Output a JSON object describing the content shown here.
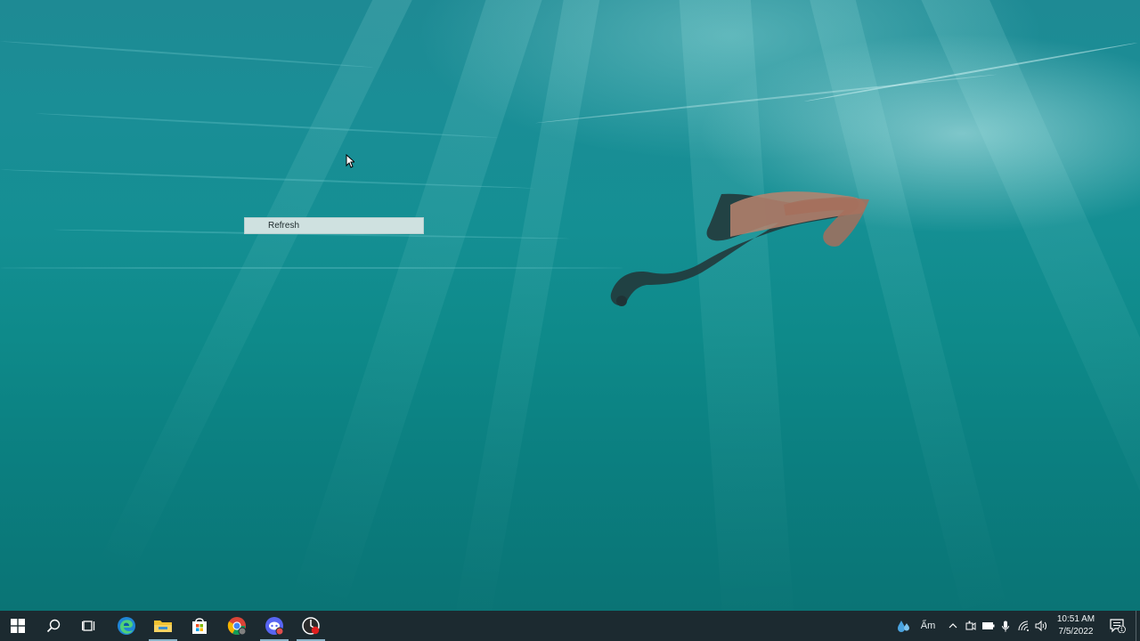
{
  "context_menu": {
    "items": [
      {
        "label": "Refresh",
        "highlighted": true
      }
    ]
  },
  "taskbar": {
    "buttons": [
      {
        "name": "start",
        "icon": "windows-logo-icon"
      },
      {
        "name": "search",
        "icon": "search-icon"
      },
      {
        "name": "task-view",
        "icon": "task-view-icon"
      },
      {
        "name": "edge",
        "icon": "edge-browser-icon"
      },
      {
        "name": "file-explorer",
        "icon": "folder-icon",
        "running": true
      },
      {
        "name": "microsoft-store",
        "icon": "store-bag-icon"
      },
      {
        "name": "chrome",
        "icon": "chrome-icon"
      },
      {
        "name": "chat-app",
        "icon": "chat-app-icon"
      },
      {
        "name": "recorder",
        "icon": "recorder-icon",
        "running": true
      }
    ],
    "tray": {
      "weather_text": "Ẩm",
      "icons": [
        "weather-drop-icon",
        "chevron-up-icon",
        "meet-now-icon",
        "battery-icon",
        "microphone-icon",
        "wifi-icon",
        "volume-icon"
      ],
      "time": "10:51 AM",
      "date": "7/5/2022",
      "notification_count": "1"
    }
  },
  "colors": {
    "taskbar": "#1c2a30",
    "water_top": "#1e8a94",
    "water_bottom": "#0a7475",
    "menu_highlight": "#cfe1e0"
  }
}
